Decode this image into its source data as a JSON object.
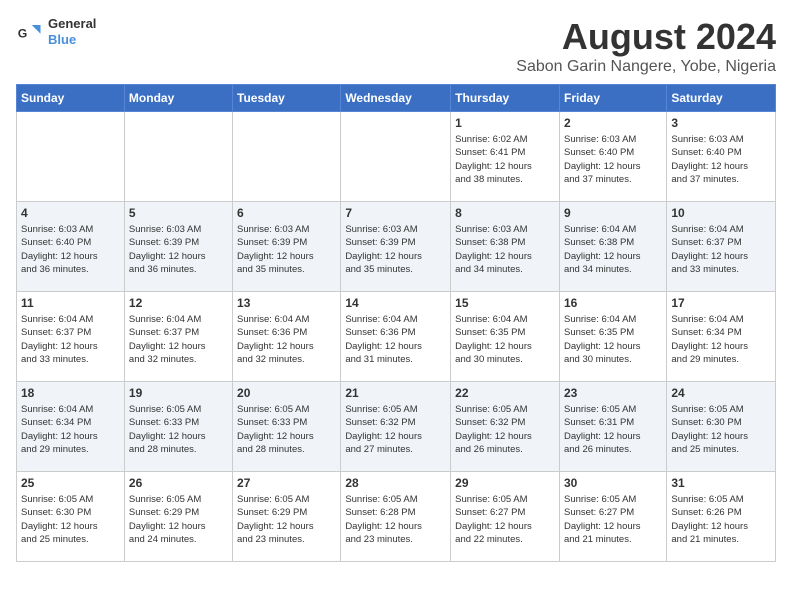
{
  "header": {
    "logo_general": "General",
    "logo_blue": "Blue",
    "month_title": "August 2024",
    "location": "Sabon Garin Nangere, Yobe, Nigeria"
  },
  "days_of_week": [
    "Sunday",
    "Monday",
    "Tuesday",
    "Wednesday",
    "Thursday",
    "Friday",
    "Saturday"
  ],
  "weeks": [
    {
      "days": [
        {
          "number": "",
          "info": ""
        },
        {
          "number": "",
          "info": ""
        },
        {
          "number": "",
          "info": ""
        },
        {
          "number": "",
          "info": ""
        },
        {
          "number": "1",
          "info": "Sunrise: 6:02 AM\nSunset: 6:41 PM\nDaylight: 12 hours\nand 38 minutes."
        },
        {
          "number": "2",
          "info": "Sunrise: 6:03 AM\nSunset: 6:40 PM\nDaylight: 12 hours\nand 37 minutes."
        },
        {
          "number": "3",
          "info": "Sunrise: 6:03 AM\nSunset: 6:40 PM\nDaylight: 12 hours\nand 37 minutes."
        }
      ]
    },
    {
      "days": [
        {
          "number": "4",
          "info": "Sunrise: 6:03 AM\nSunset: 6:40 PM\nDaylight: 12 hours\nand 36 minutes."
        },
        {
          "number": "5",
          "info": "Sunrise: 6:03 AM\nSunset: 6:39 PM\nDaylight: 12 hours\nand 36 minutes."
        },
        {
          "number": "6",
          "info": "Sunrise: 6:03 AM\nSunset: 6:39 PM\nDaylight: 12 hours\nand 35 minutes."
        },
        {
          "number": "7",
          "info": "Sunrise: 6:03 AM\nSunset: 6:39 PM\nDaylight: 12 hours\nand 35 minutes."
        },
        {
          "number": "8",
          "info": "Sunrise: 6:03 AM\nSunset: 6:38 PM\nDaylight: 12 hours\nand 34 minutes."
        },
        {
          "number": "9",
          "info": "Sunrise: 6:04 AM\nSunset: 6:38 PM\nDaylight: 12 hours\nand 34 minutes."
        },
        {
          "number": "10",
          "info": "Sunrise: 6:04 AM\nSunset: 6:37 PM\nDaylight: 12 hours\nand 33 minutes."
        }
      ]
    },
    {
      "days": [
        {
          "number": "11",
          "info": "Sunrise: 6:04 AM\nSunset: 6:37 PM\nDaylight: 12 hours\nand 33 minutes."
        },
        {
          "number": "12",
          "info": "Sunrise: 6:04 AM\nSunset: 6:37 PM\nDaylight: 12 hours\nand 32 minutes."
        },
        {
          "number": "13",
          "info": "Sunrise: 6:04 AM\nSunset: 6:36 PM\nDaylight: 12 hours\nand 32 minutes."
        },
        {
          "number": "14",
          "info": "Sunrise: 6:04 AM\nSunset: 6:36 PM\nDaylight: 12 hours\nand 31 minutes."
        },
        {
          "number": "15",
          "info": "Sunrise: 6:04 AM\nSunset: 6:35 PM\nDaylight: 12 hours\nand 30 minutes."
        },
        {
          "number": "16",
          "info": "Sunrise: 6:04 AM\nSunset: 6:35 PM\nDaylight: 12 hours\nand 30 minutes."
        },
        {
          "number": "17",
          "info": "Sunrise: 6:04 AM\nSunset: 6:34 PM\nDaylight: 12 hours\nand 29 minutes."
        }
      ]
    },
    {
      "days": [
        {
          "number": "18",
          "info": "Sunrise: 6:04 AM\nSunset: 6:34 PM\nDaylight: 12 hours\nand 29 minutes."
        },
        {
          "number": "19",
          "info": "Sunrise: 6:05 AM\nSunset: 6:33 PM\nDaylight: 12 hours\nand 28 minutes."
        },
        {
          "number": "20",
          "info": "Sunrise: 6:05 AM\nSunset: 6:33 PM\nDaylight: 12 hours\nand 28 minutes."
        },
        {
          "number": "21",
          "info": "Sunrise: 6:05 AM\nSunset: 6:32 PM\nDaylight: 12 hours\nand 27 minutes."
        },
        {
          "number": "22",
          "info": "Sunrise: 6:05 AM\nSunset: 6:32 PM\nDaylight: 12 hours\nand 26 minutes."
        },
        {
          "number": "23",
          "info": "Sunrise: 6:05 AM\nSunset: 6:31 PM\nDaylight: 12 hours\nand 26 minutes."
        },
        {
          "number": "24",
          "info": "Sunrise: 6:05 AM\nSunset: 6:30 PM\nDaylight: 12 hours\nand 25 minutes."
        }
      ]
    },
    {
      "days": [
        {
          "number": "25",
          "info": "Sunrise: 6:05 AM\nSunset: 6:30 PM\nDaylight: 12 hours\nand 25 minutes."
        },
        {
          "number": "26",
          "info": "Sunrise: 6:05 AM\nSunset: 6:29 PM\nDaylight: 12 hours\nand 24 minutes."
        },
        {
          "number": "27",
          "info": "Sunrise: 6:05 AM\nSunset: 6:29 PM\nDaylight: 12 hours\nand 23 minutes."
        },
        {
          "number": "28",
          "info": "Sunrise: 6:05 AM\nSunset: 6:28 PM\nDaylight: 12 hours\nand 23 minutes."
        },
        {
          "number": "29",
          "info": "Sunrise: 6:05 AM\nSunset: 6:27 PM\nDaylight: 12 hours\nand 22 minutes."
        },
        {
          "number": "30",
          "info": "Sunrise: 6:05 AM\nSunset: 6:27 PM\nDaylight: 12 hours\nand 21 minutes."
        },
        {
          "number": "31",
          "info": "Sunrise: 6:05 AM\nSunset: 6:26 PM\nDaylight: 12 hours\nand 21 minutes."
        }
      ]
    }
  ]
}
